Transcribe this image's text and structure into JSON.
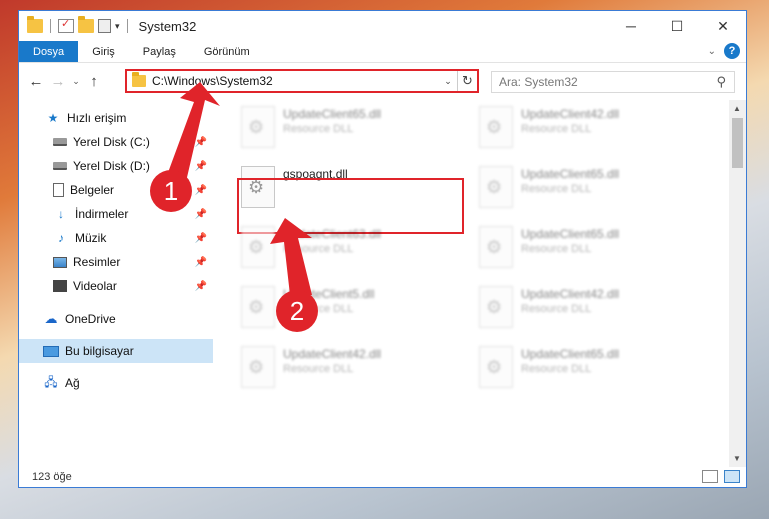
{
  "window": {
    "title": "System32",
    "minimize_glyph": "─",
    "maximize_glyph": "☐",
    "close_glyph": "✕"
  },
  "ribbon": {
    "tabs": [
      "Dosya",
      "Giriş",
      "Paylaş",
      "Görünüm"
    ],
    "help_glyph": "?"
  },
  "nav": {
    "back_glyph": "←",
    "forward_glyph": "→",
    "recent_glyph": "⌄",
    "up_glyph": "↑",
    "address_path": "C:\\Windows\\System32",
    "address_dropdown_glyph": "⌄",
    "refresh_glyph": "↻",
    "search_placeholder": "Ara: System32",
    "search_glyph": "⚲"
  },
  "sidebar": {
    "items": [
      {
        "label": "Hızlı erişim",
        "icon": "star-icon",
        "pinned": false
      },
      {
        "label": "Yerel Disk (C:)",
        "icon": "drive-icon",
        "pinned": true
      },
      {
        "label": "Yerel Disk (D:)",
        "icon": "drive-icon",
        "pinned": true
      },
      {
        "label": "Belgeler",
        "icon": "documents-icon",
        "pinned": true
      },
      {
        "label": "İndirmeler",
        "icon": "downloads-icon",
        "pinned": true
      },
      {
        "label": "Müzik",
        "icon": "music-icon",
        "pinned": true
      },
      {
        "label": "Resimler",
        "icon": "pictures-icon",
        "pinned": true
      },
      {
        "label": "Videolar",
        "icon": "videos-icon",
        "pinned": true
      },
      {
        "label": "OneDrive",
        "icon": "onedrive-icon",
        "pinned": false
      },
      {
        "label": "Bu bilgisayar",
        "icon": "this-pc-icon",
        "pinned": false,
        "selected": true
      },
      {
        "label": "Ağ",
        "icon": "network-icon",
        "pinned": false
      }
    ]
  },
  "files": [
    {
      "name": "UpdateClient65.dll",
      "type": "Resource DLL",
      "blurred": true
    },
    {
      "name": "UpdateClient42.dll",
      "type": "Resource DLL",
      "blurred": true
    },
    {
      "name": "gspoagnt.dll",
      "type": "",
      "blurred": false,
      "highlighted": true
    },
    {
      "name": "UpdateClient65.dll",
      "type": "Resource DLL",
      "blurred": true
    },
    {
      "name": "UpdateClient63.dll",
      "type": "Resource DLL",
      "blurred": true
    },
    {
      "name": "UpdateClient65.dll",
      "type": "Resource DLL",
      "blurred": true
    },
    {
      "name": "UpdateClient5.dll",
      "type": "Resource DLL",
      "blurred": true
    },
    {
      "name": "UpdateClient42.dll",
      "type": "Resource DLL",
      "blurred": true
    },
    {
      "name": "UpdateClient42.dll",
      "type": "Resource DLL",
      "blurred": true
    },
    {
      "name": "UpdateClient65.dll",
      "type": "Resource DLL",
      "blurred": true
    }
  ],
  "status": {
    "item_count": "123 öğe"
  },
  "annotations": {
    "step1": "1",
    "step2": "2",
    "highlight_color": "#e0242a"
  },
  "colors": {
    "accent": "#1979ca",
    "selection": "#cce4f7"
  }
}
